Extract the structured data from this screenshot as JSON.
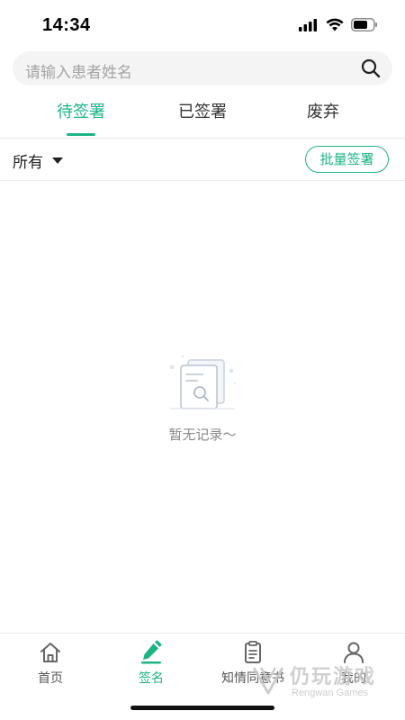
{
  "status_bar": {
    "time": "14:34",
    "icons": [
      "cellular-signal-icon",
      "wifi-icon",
      "battery-icon"
    ]
  },
  "search": {
    "placeholder": "请输入患者姓名",
    "icon": "search-icon"
  },
  "tabs": [
    {
      "label": "待签署",
      "active": true
    },
    {
      "label": "已签署",
      "active": false
    },
    {
      "label": "废弃",
      "active": false
    }
  ],
  "filter": {
    "selected": "所有",
    "batch_sign_label": "批量签署"
  },
  "empty_state": {
    "icon": "document-search-icon",
    "message": "暂无记录～"
  },
  "bottom_nav": [
    {
      "label": "首页",
      "icon": "home-icon",
      "active": false
    },
    {
      "label": "签名",
      "icon": "pen-sign-icon",
      "active": true
    },
    {
      "label": "知情同意书",
      "icon": "clipboard-icon",
      "active": false
    },
    {
      "label": "我的",
      "icon": "user-icon",
      "active": false
    }
  ],
  "watermark": {
    "title": "仍玩游戏",
    "subtitle": "Rengwan Games"
  },
  "colors": {
    "accent": "#1cb485",
    "text_primary": "#222222",
    "text_muted": "#a4a4a4",
    "search_bg": "#f4f4f4"
  }
}
